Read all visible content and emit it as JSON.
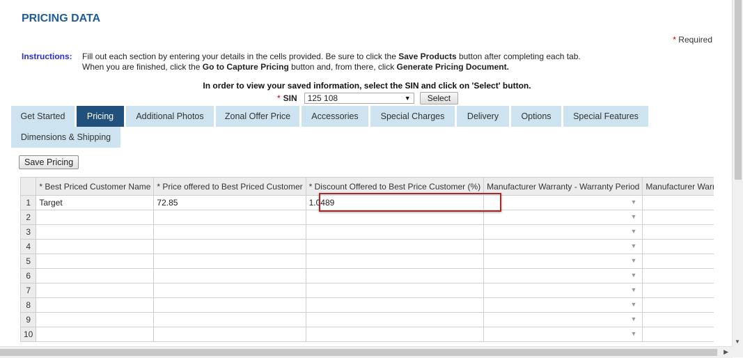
{
  "page_title": "PRICING DATA",
  "required_note": {
    "star": "*",
    "text": "Required"
  },
  "instructions": {
    "label": "Instructions:",
    "line1_a": "Fill out each section by entering your details in the cells provided. Be sure to click the ",
    "line1_b": "Save Products",
    "line1_c": " button after completing each tab.",
    "line2_a": "When you are finished, click the ",
    "line2_b": "Go to Capture Pricing",
    "line2_c": " button and, from there, click ",
    "line2_d": "Generate Pricing Document."
  },
  "sin": {
    "instruction": "In order to view your saved information, select the SIN and click on 'Select' button.",
    "star": "*",
    "label": "SIN",
    "value": "125 108",
    "select_button": "Select"
  },
  "tabs": [
    {
      "label": "Get Started",
      "active": false
    },
    {
      "label": "Pricing",
      "active": true
    },
    {
      "label": "Additional Photos",
      "active": false
    },
    {
      "label": "Zonal Offer Price",
      "active": false
    },
    {
      "label": "Accessories",
      "active": false
    },
    {
      "label": "Special Charges",
      "active": false
    },
    {
      "label": "Delivery",
      "active": false
    },
    {
      "label": "Options",
      "active": false
    },
    {
      "label": "Special Features",
      "active": false
    },
    {
      "label": "Dimensions & Shipping",
      "active": false
    }
  ],
  "save_button": "Save Pricing",
  "grid": {
    "headers": [
      "",
      "* Best Priced Customer Name",
      "* Price offered to Best Priced Customer",
      "* Discount Offered to Best Price Customer (%)",
      "Manufacturer Warranty - Warranty Period",
      "Manufacturer Warranty"
    ],
    "rows": [
      {
        "num": "1",
        "name": "Target",
        "price": "72.85",
        "discount": "1.0489"
      },
      {
        "num": "2",
        "name": "",
        "price": "",
        "discount": ""
      },
      {
        "num": "3",
        "name": "",
        "price": "",
        "discount": ""
      },
      {
        "num": "4",
        "name": "",
        "price": "",
        "discount": ""
      },
      {
        "num": "5",
        "name": "",
        "price": "",
        "discount": ""
      },
      {
        "num": "6",
        "name": "",
        "price": "",
        "discount": ""
      },
      {
        "num": "7",
        "name": "",
        "price": "",
        "discount": ""
      },
      {
        "num": "8",
        "name": "",
        "price": "",
        "discount": ""
      },
      {
        "num": "9",
        "name": "",
        "price": "",
        "discount": ""
      },
      {
        "num": "10",
        "name": "",
        "price": "",
        "discount": ""
      }
    ],
    "dropdown_glyph": "▼"
  },
  "colors": {
    "title": "#1f5c99",
    "tab_inactive": "#cde3ef",
    "tab_active": "#22507c",
    "highlight": "#a52a2a",
    "required_star": "#c00000"
  }
}
